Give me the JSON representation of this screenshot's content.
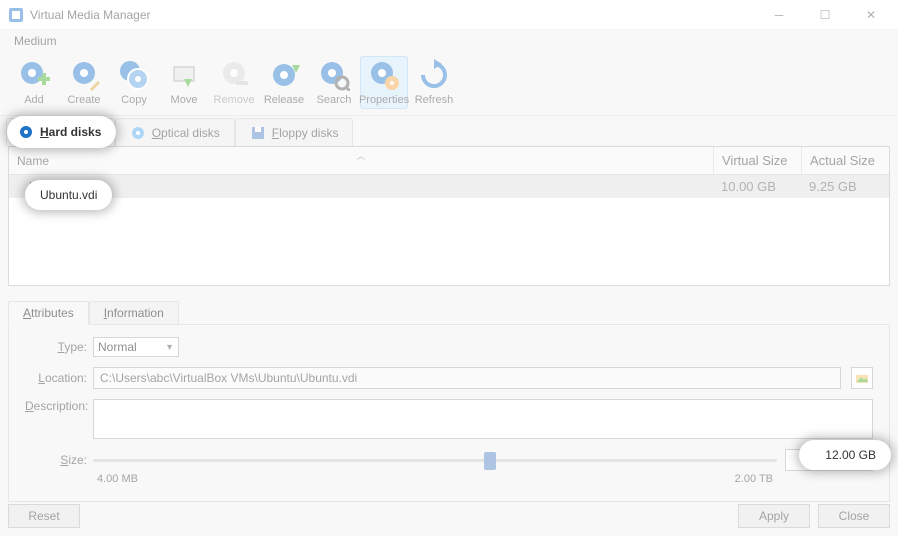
{
  "title": "Virtual Media Manager",
  "menu": {
    "medium": "Medium"
  },
  "toolbar": {
    "add": "Add",
    "create": "Create",
    "copy": "Copy",
    "move": "Move",
    "remove": "Remove",
    "release": "Release",
    "search": "Search",
    "properties": "Properties",
    "refresh": "Refresh"
  },
  "tabs": {
    "hard": "Hard disks",
    "optical": "Optical disks",
    "floppy": "Floppy disks"
  },
  "columns": {
    "name": "Name",
    "virtual": "Virtual Size",
    "actual": "Actual Size"
  },
  "rows": [
    {
      "name": "Ubuntu.vdi",
      "virtual": "10.00 GB",
      "actual": "9.25 GB"
    }
  ],
  "subtabs": {
    "attributes": "Attributes",
    "information": "Information"
  },
  "form": {
    "type_label": "Type:",
    "type_value": "Normal",
    "location_label": "Location:",
    "location_value": "C:\\Users\\abc\\VirtualBox VMs\\Ubuntu\\Ubuntu.vdi",
    "description_label": "Description:",
    "size_label": "Size:",
    "size_value": "12.00 GB",
    "scale_min": "4.00 MB",
    "scale_max": "2.00 TB",
    "slider_percent": 58
  },
  "buttons": {
    "reset": "Reset",
    "apply": "Apply",
    "close": "Close"
  }
}
